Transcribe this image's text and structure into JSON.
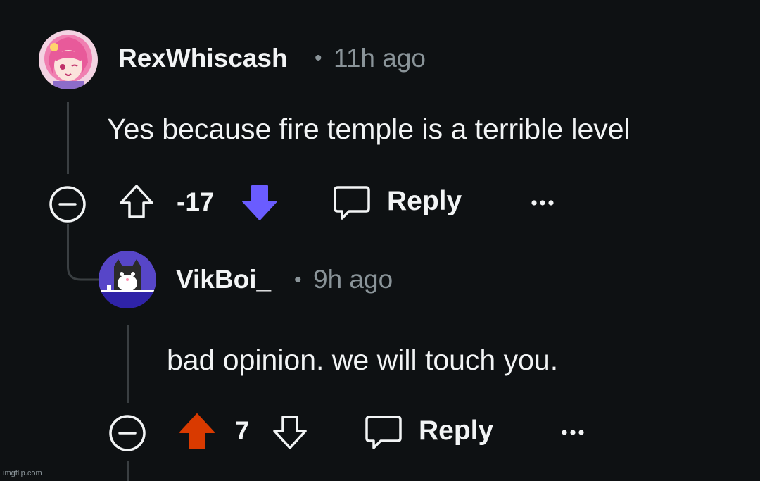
{
  "comments": [
    {
      "username": "RexWhiscash",
      "separator": "•",
      "time": "11h ago",
      "body": "Yes because fire temple is a terrible level",
      "score": "-17",
      "vote_state": "downvoted",
      "reply_label": "Reply",
      "more_label": "•••",
      "avatar_icon": "anime-girl-avatar-icon",
      "accent_color": "#6a5cff"
    },
    {
      "username": "VikBoi_",
      "separator": "•",
      "time": "9h ago",
      "body": "bad opinion. we will touch you.",
      "score": "7",
      "vote_state": "upvoted",
      "reply_label": "Reply",
      "more_label": "•••",
      "avatar_icon": "cat-avatar-icon",
      "accent_color": "#d93a00"
    }
  ],
  "watermark": "imgflip.com"
}
